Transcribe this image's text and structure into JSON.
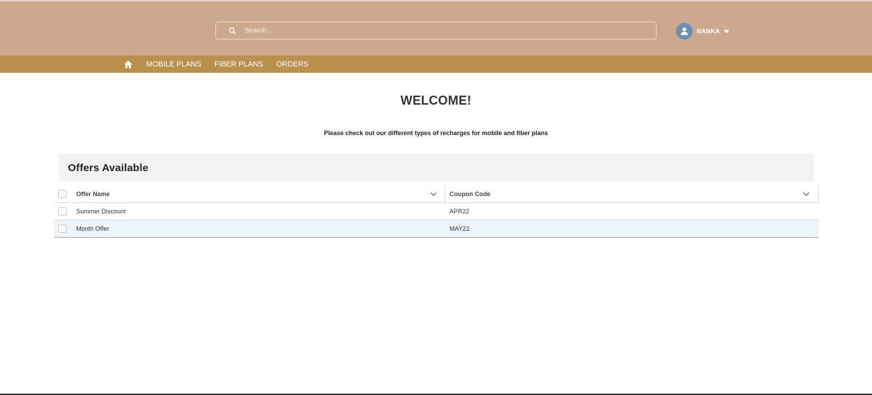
{
  "header": {
    "search": {
      "placeholder": "Search..."
    },
    "user": {
      "name": "NANKA"
    }
  },
  "nav": {
    "items": [
      {
        "label": "MOBILE PLANS"
      },
      {
        "label": "FIBER PLANS"
      },
      {
        "label": "ORDERS"
      }
    ]
  },
  "main": {
    "welcome": "WELCOME!",
    "subtitle": "Please check out our different types of recharges for mobile and fiber plans"
  },
  "offers": {
    "title": "Offers Available",
    "columns": [
      {
        "label": "Offer Name"
      },
      {
        "label": "Coupon Code"
      }
    ],
    "rows": [
      {
        "name": "Summer Discount",
        "code": "APR22"
      },
      {
        "name": "Month Offer",
        "code": "MAY22"
      }
    ]
  },
  "colors": {
    "header_bg": "#cca88f",
    "nav_bg": "#b88f4d",
    "avatar_bg": "#6e8fb5"
  }
}
